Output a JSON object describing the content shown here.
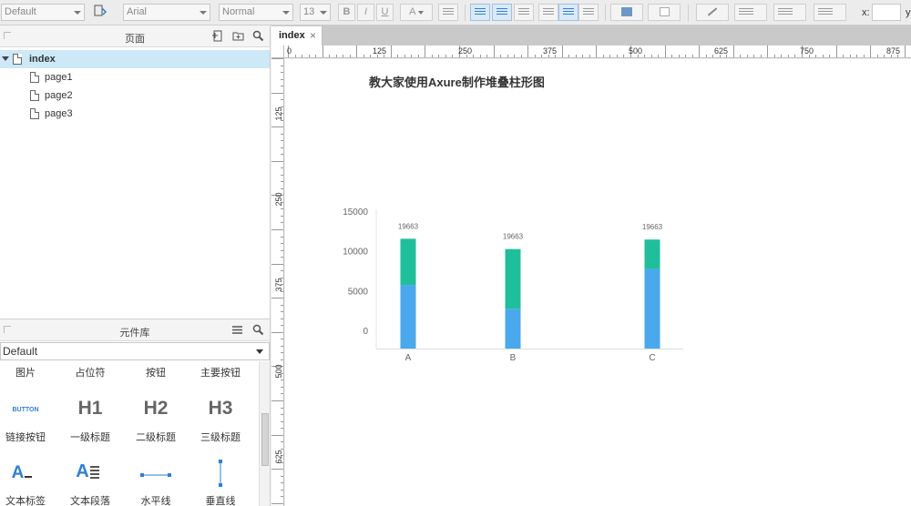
{
  "toolbar": {
    "style_select": "Default",
    "font_family": "Arial",
    "font_weight": "Normal",
    "font_size": "13",
    "bold": "B",
    "italic": "I",
    "underline": "U",
    "font_color": "A",
    "x_label": "x:",
    "y_label": "y"
  },
  "pages_panel": {
    "title": "页面",
    "items": [
      {
        "label": "index"
      },
      {
        "label": "page1"
      },
      {
        "label": "page2"
      },
      {
        "label": "page3"
      }
    ]
  },
  "widget_library": {
    "title": "元件库",
    "library_select": "Default",
    "widgets": [
      {
        "label": "图片"
      },
      {
        "label": "占位符"
      },
      {
        "label": "按钮"
      },
      {
        "label": "主要按钮"
      },
      {
        "label": "链接按钮",
        "icon_text": "BUTTON"
      },
      {
        "label": "一级标题",
        "icon_text": "H1"
      },
      {
        "label": "二级标题",
        "icon_text": "H2"
      },
      {
        "label": "三级标题",
        "icon_text": "H3"
      },
      {
        "label": "文本标签",
        "icon_text": "A"
      },
      {
        "label": "文本段落",
        "icon_text": "A"
      },
      {
        "label": "水平线"
      },
      {
        "label": "垂直线"
      }
    ]
  },
  "editor": {
    "tab_label": "index",
    "tab_close": "×",
    "page_heading": "教大家使用Axure制作堆叠柱形图",
    "ruler_h_labels": [
      "0",
      "125",
      "250",
      "375",
      "500",
      "625",
      "750",
      "875"
    ],
    "ruler_v_labels": [
      "125",
      "250",
      "375",
      "500",
      "625"
    ]
  },
  "chart_data": {
    "type": "bar",
    "stacked": true,
    "categories": [
      "A",
      "B",
      "C"
    ],
    "series": [
      {
        "values": [
          8000,
          5000,
          10000
        ],
        "color": "#4aa8ec"
      },
      {
        "values": [
          5800,
          7500,
          3700
        ],
        "color": "#1fbf9b"
      }
    ],
    "data_labels": [
      "19663",
      "19663",
      "19663"
    ],
    "y_ticks": [
      "0",
      "5000",
      "10000",
      "15000"
    ],
    "ylim": [
      0,
      17500
    ],
    "grid": false
  }
}
